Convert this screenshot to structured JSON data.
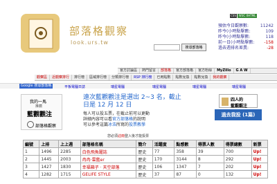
{
  "header": {
    "site_title": "部落格觀察",
    "site_url": "look.urs.tw",
    "search_placeholder": "",
    "search_button": "搜尋部落格",
    "badge_left": "CSS",
    "badge_right": "W3C XHTML"
  },
  "stats": [
    {
      "label": "預估今日觀察數:",
      "value": "11242",
      "neg": false
    },
    {
      "label": "昨今(小時點擊數:",
      "value": "109",
      "neg": false
    },
    {
      "label": "昨今(小時點擊數:",
      "value": "118",
      "neg": false
    },
    {
      "label": "前一日(小時點擊數:",
      "value": "-158",
      "neg": true
    },
    {
      "label": "過去週排名差異:",
      "value": "-28",
      "neg": true
    }
  ],
  "nav_top": [
    "官方討論區",
    "熱門留言",
    "部落格",
    "官方部落格",
    "官方粉絲",
    "MyZillo",
    "G A W"
  ],
  "nav_bottom": [
    "觀察區",
    "近觀察排行",
    "排行榜",
    "區域排行榜",
    "分類排行榜",
    "RSP 排行榜",
    "已用點數",
    "點數兌換",
    "點數兌換",
    "我的觀察"
  ],
  "band": {
    "google": "Google 搜尋部落格",
    "links": [
      "平板電腦日誌",
      "瑞星電腦",
      "瑞星電腦",
      "瑞星電腦",
      "瑞星電腦"
    ]
  },
  "left_box": {
    "line1": "我的一馬",
    "line2": "推薦",
    "line3": "藍觀觀注",
    "line4": "部落格觀察"
  },
  "announce": {
    "line1": "遠次藍觀觀注是選出 2~3 名，截止",
    "line2": "日是 12 月 12 日",
    "sub1": "每人可以投五票，在截止前可以更動",
    "sub2_pre": "詳細內容可以看",
    "sub2_link": "官方部落格",
    "sub2_post": "的說明",
    "sub3_pre": "可以參考這篇",
    "sub3_link1": "冰浩",
    "sub3_mid": "所寫的",
    "sub3_link2": "投票教學",
    "count_pre": "您必須",
    "count_link": "註冊",
    "count_mid": "登入",
    "count_post": "後才能投票"
  },
  "right_box": {
    "line1": "四人的",
    "line2": "藍觀觀注",
    "banner": "過去我投 (1篇)"
  },
  "table": {
    "headers": [
      "編號",
      "上排",
      "上上週",
      "部落格名稱",
      "簡介",
      "活躍度",
      "點感數",
      "得票人數",
      "得票總數",
      "新票"
    ],
    "rows": [
      [
        "1",
        "1496",
        "2285",
        "白色飛魚躍誌",
        "歷史",
        "77",
        "358",
        "39",
        "700",
        "Up!"
      ],
      [
        "2",
        "1445",
        "2003",
        "冉冉·雲藍er",
        "歷史",
        "170",
        "3144",
        "8",
        "292",
        "Up!"
      ],
      [
        "3",
        "1427",
        "1830",
        "幸福箱子 · 天空部落",
        "歷史",
        "106",
        "1347",
        "7",
        "202",
        "Up!"
      ],
      [
        "4",
        "1282",
        "1715",
        "GELIFE STYLE",
        "歷史",
        "37",
        "87",
        "0",
        "132",
        "Up!"
      ]
    ]
  }
}
